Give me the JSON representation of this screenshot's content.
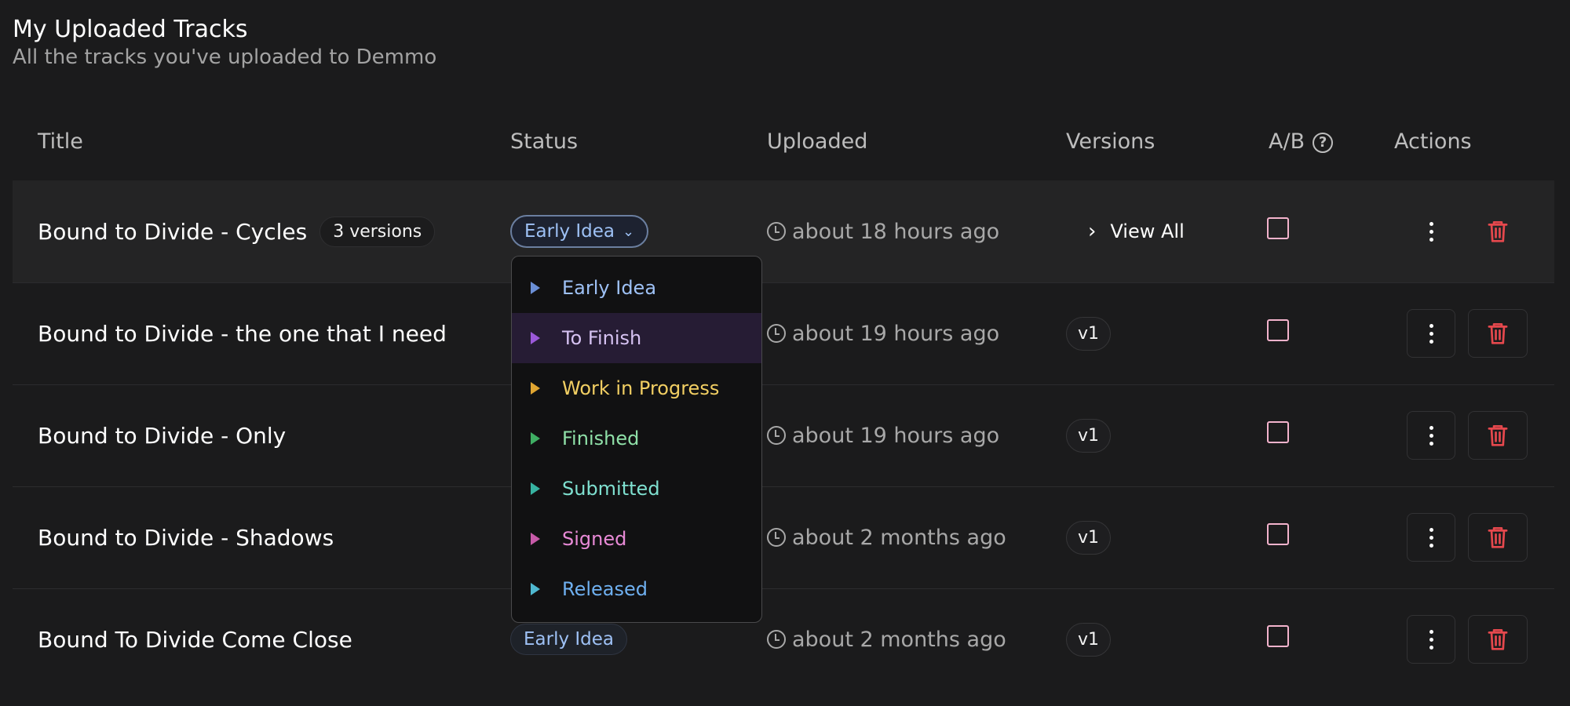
{
  "page": {
    "title": "My Uploaded Tracks",
    "subtitle": "All the tracks you've uploaded to Demmo"
  },
  "table": {
    "headers": {
      "title": "Title",
      "status": "Status",
      "uploaded": "Uploaded",
      "versions": "Versions",
      "ab": "A/B",
      "actions": "Actions"
    },
    "rows": [
      {
        "title": "Bound to Divide - Cycles",
        "versions_badge": "3 versions",
        "status": "Early Idea",
        "uploaded": "about 18 hours ago",
        "versions": "View All",
        "ab_checked": false
      },
      {
        "title": "Bound to Divide - the one that I need",
        "status": "",
        "uploaded": "about 19 hours ago",
        "versions": "v1",
        "ab_checked": false
      },
      {
        "title": "Bound to Divide - Only",
        "status": "",
        "uploaded": "about 19 hours ago",
        "versions": "v1",
        "ab_checked": false
      },
      {
        "title": "Bound to Divide - Shadows",
        "status": "",
        "uploaded": "about 2 months ago",
        "versions": "v1",
        "ab_checked": false
      },
      {
        "title": "Bound To Divide Come Close",
        "status": "Early Idea",
        "uploaded": "about 2 months ago",
        "versions": "v1",
        "ab_checked": false
      }
    ]
  },
  "status_dropdown": {
    "open": true,
    "selected": "To Finish",
    "options": [
      {
        "label": "Early Idea",
        "color": "#9ec1f5",
        "icon": "#6b8fd6"
      },
      {
        "label": "To Finish",
        "color": "#d6c2f2",
        "icon": "#9b59d9"
      },
      {
        "label": "Work in Progress",
        "color": "#f2cf63",
        "icon": "#e0a531"
      },
      {
        "label": "Finished",
        "color": "#8fe0a8",
        "icon": "#3fae63"
      },
      {
        "label": "Submitted",
        "color": "#7fe0d0",
        "icon": "#37b3a1"
      },
      {
        "label": "Signed",
        "color": "#e88ad6",
        "icon": "#c75aa8"
      },
      {
        "label": "Released",
        "color": "#6fb0f0",
        "icon": "#4fb8d0"
      }
    ]
  },
  "colors": {
    "background": "#1b1b1c",
    "highlight_row": "#242425",
    "delete_red": "#e5484d",
    "checkbox_border": "#f3b3cc"
  },
  "icons": {
    "uploaded": "clock-icon",
    "view_all": "chevron-right-icon",
    "ab_help": "question-circle-icon",
    "more": "kebab-icon",
    "delete": "trash-icon",
    "status_caret": "chevron-down-icon",
    "option": "triangle-play-icon"
  }
}
